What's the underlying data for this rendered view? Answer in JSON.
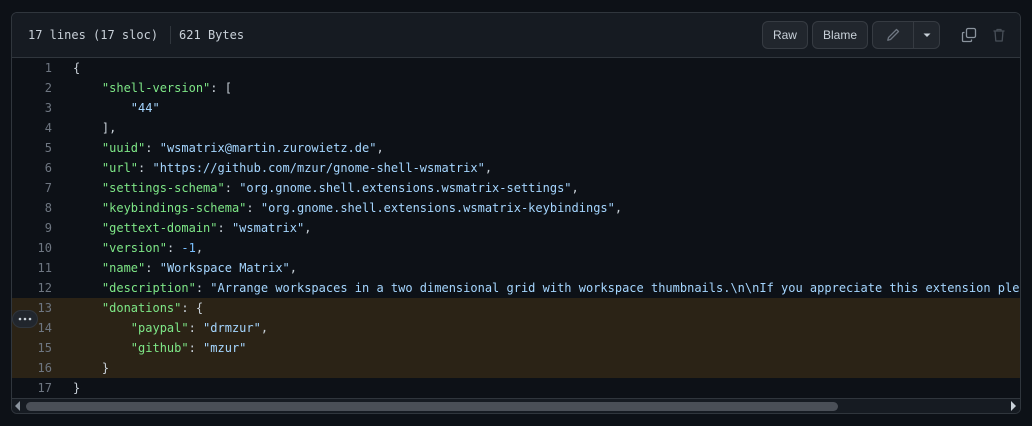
{
  "header": {
    "lines_info": "17 lines (17 sloc)",
    "size": "621 Bytes",
    "raw_label": "Raw",
    "blame_label": "Blame",
    "edit_icon": "pencil-icon",
    "dropdown_icon": "triangle-down-icon",
    "copy_icon": "copy-icon",
    "delete_icon": "trash-icon"
  },
  "colors": {
    "key": "#7ee787",
    "string": "#a5d6ff",
    "number": "#79c0ff",
    "highlight": "#2b2316",
    "highlight_bar": "#bb8009"
  },
  "highlighted_lines": [
    13,
    14,
    15,
    16
  ],
  "lines": [
    {
      "n": "1",
      "indent": "",
      "tokens": [
        {
          "t": "p",
          "v": "{"
        }
      ]
    },
    {
      "n": "2",
      "indent": "    ",
      "tokens": [
        {
          "t": "k",
          "v": "\"shell-version\""
        },
        {
          "t": "p",
          "v": ": ["
        }
      ]
    },
    {
      "n": "3",
      "indent": "        ",
      "tokens": [
        {
          "t": "s",
          "v": "\"44\""
        }
      ]
    },
    {
      "n": "4",
      "indent": "    ",
      "tokens": [
        {
          "t": "p",
          "v": "],"
        }
      ]
    },
    {
      "n": "5",
      "indent": "    ",
      "tokens": [
        {
          "t": "k",
          "v": "\"uuid\""
        },
        {
          "t": "p",
          "v": ": "
        },
        {
          "t": "s",
          "v": "\"wsmatrix@martin.zurowietz.de\""
        },
        {
          "t": "p",
          "v": ","
        }
      ]
    },
    {
      "n": "6",
      "indent": "    ",
      "tokens": [
        {
          "t": "k",
          "v": "\"url\""
        },
        {
          "t": "p",
          "v": ": "
        },
        {
          "t": "s",
          "v": "\"https://github.com/mzur/gnome-shell-wsmatrix\""
        },
        {
          "t": "p",
          "v": ","
        }
      ]
    },
    {
      "n": "7",
      "indent": "    ",
      "tokens": [
        {
          "t": "k",
          "v": "\"settings-schema\""
        },
        {
          "t": "p",
          "v": ": "
        },
        {
          "t": "s",
          "v": "\"org.gnome.shell.extensions.wsmatrix-settings\""
        },
        {
          "t": "p",
          "v": ","
        }
      ]
    },
    {
      "n": "8",
      "indent": "    ",
      "tokens": [
        {
          "t": "k",
          "v": "\"keybindings-schema\""
        },
        {
          "t": "p",
          "v": ": "
        },
        {
          "t": "s",
          "v": "\"org.gnome.shell.extensions.wsmatrix-keybindings\""
        },
        {
          "t": "p",
          "v": ","
        }
      ]
    },
    {
      "n": "9",
      "indent": "    ",
      "tokens": [
        {
          "t": "k",
          "v": "\"gettext-domain\""
        },
        {
          "t": "p",
          "v": ": "
        },
        {
          "t": "s",
          "v": "\"wsmatrix\""
        },
        {
          "t": "p",
          "v": ","
        }
      ]
    },
    {
      "n": "10",
      "indent": "    ",
      "tokens": [
        {
          "t": "k",
          "v": "\"version\""
        },
        {
          "t": "p",
          "v": ": "
        },
        {
          "t": "n",
          "v": "-1"
        },
        {
          "t": "p",
          "v": ","
        }
      ]
    },
    {
      "n": "11",
      "indent": "    ",
      "tokens": [
        {
          "t": "k",
          "v": "\"name\""
        },
        {
          "t": "p",
          "v": ": "
        },
        {
          "t": "s",
          "v": "\"Workspace Matrix\""
        },
        {
          "t": "p",
          "v": ","
        }
      ]
    },
    {
      "n": "12",
      "indent": "    ",
      "tokens": [
        {
          "t": "k",
          "v": "\"description\""
        },
        {
          "t": "p",
          "v": ": "
        },
        {
          "t": "s",
          "v": "\"Arrange workspaces in a two dimensional grid with workspace thumbnails.\\n\\nIf you appreciate this extension plea"
        }
      ]
    },
    {
      "n": "13",
      "indent": "    ",
      "tokens": [
        {
          "t": "k",
          "v": "\"donations\""
        },
        {
          "t": "p",
          "v": ": {"
        }
      ]
    },
    {
      "n": "14",
      "indent": "        ",
      "tokens": [
        {
          "t": "k",
          "v": "\"paypal\""
        },
        {
          "t": "p",
          "v": ": "
        },
        {
          "t": "s",
          "v": "\"drmzur\""
        },
        {
          "t": "p",
          "v": ","
        }
      ]
    },
    {
      "n": "15",
      "indent": "        ",
      "tokens": [
        {
          "t": "k",
          "v": "\"github\""
        },
        {
          "t": "p",
          "v": ": "
        },
        {
          "t": "s",
          "v": "\"mzur\""
        }
      ]
    },
    {
      "n": "16",
      "indent": "    ",
      "tokens": [
        {
          "t": "p",
          "v": "}"
        }
      ]
    },
    {
      "n": "17",
      "indent": "",
      "tokens": [
        {
          "t": "p",
          "v": "}"
        }
      ]
    }
  ],
  "scrollbar": {
    "thumb_fraction": 0.8,
    "position": 0
  }
}
